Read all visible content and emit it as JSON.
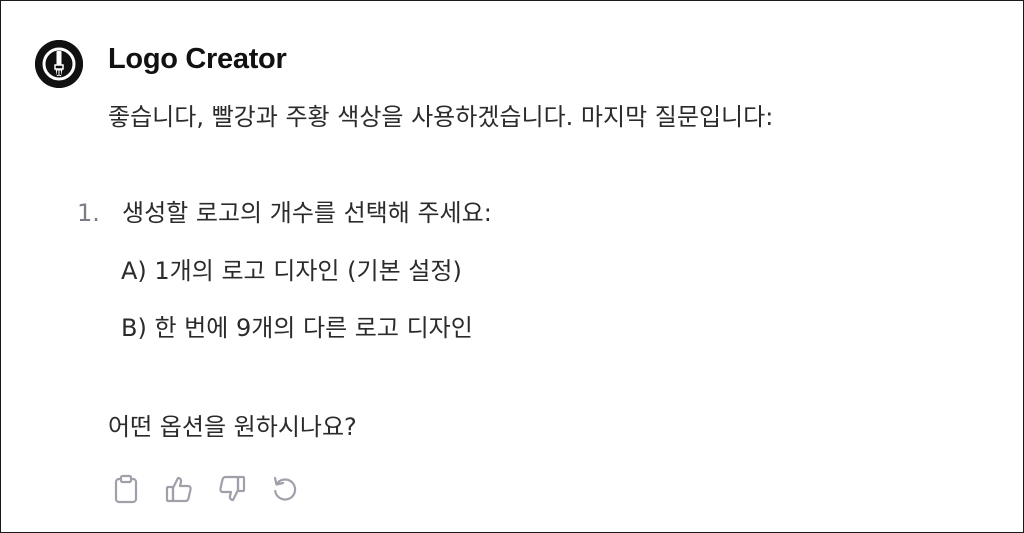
{
  "assistant": {
    "name": "Logo Creator",
    "avatar_icon": "brush-logo-icon"
  },
  "message": {
    "intro": "좋습니다, 빨강과 주황 색상을 사용하겠습니다. 마지막 질문입니다:",
    "list": [
      {
        "number": "1.",
        "text": "생성할 로고의 개수를 선택해 주세요:",
        "options": [
          "A) 1개의 로고 디자인 (기본 설정)",
          "B) 한 번에 9개의 다른 로고 디자인"
        ]
      }
    ],
    "closing": "어떤 옵션을 원하시나요?"
  },
  "actions": [
    {
      "icon": "clipboard-icon"
    },
    {
      "icon": "thumbs-up-icon"
    },
    {
      "icon": "thumbs-down-icon"
    },
    {
      "icon": "regenerate-icon"
    }
  ],
  "colors": {
    "text": "#2b2b2e",
    "muted": "#7c7c86",
    "icon": "#a0a0aa",
    "avatar_bg": "#111111"
  }
}
